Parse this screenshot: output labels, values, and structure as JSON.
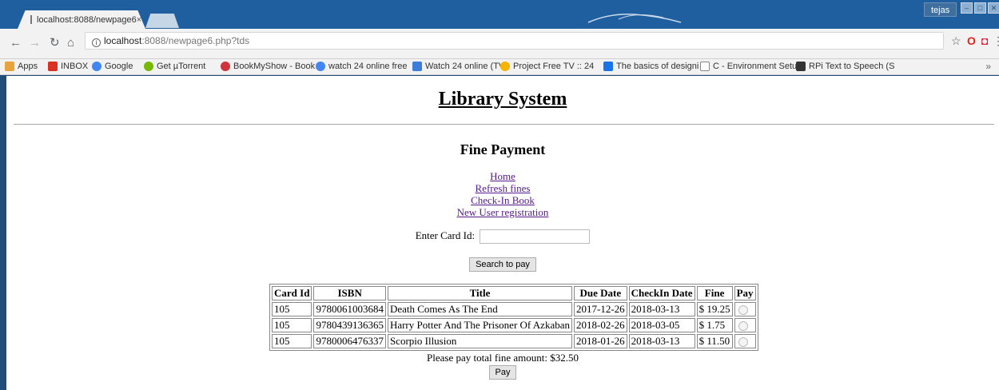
{
  "browser": {
    "tab_title": "localhost:8088/newpage6",
    "tab_close": "×",
    "url_host": "localhost",
    "url_rest": ":8088/newpage6.php?tds",
    "user": "tejas",
    "bookmarks": [
      {
        "label": "Apps",
        "color": "#e8a33d"
      },
      {
        "label": "INBOX",
        "color": "#d93025"
      },
      {
        "label": "Google",
        "color": "#4285f4"
      },
      {
        "label": "Get µTorrent",
        "color": "#76b900"
      },
      {
        "label": "BookMyShow - Book",
        "color": "#d1333d"
      },
      {
        "label": "watch 24 online free",
        "color": "#4285f4"
      },
      {
        "label": "Watch 24 online (TV",
        "color": "#3b7dd8"
      },
      {
        "label": "Project Free TV :: 24",
        "color": "#f4b400"
      },
      {
        "label": "The basics of designi",
        "color": "#1a73e8"
      },
      {
        "label": "C - Environment Setu",
        "color": "#888888"
      },
      {
        "label": "RPi Text to Speech (S",
        "color": "#333333"
      }
    ],
    "more": "»"
  },
  "page": {
    "title": "Library System",
    "subtitle": "Fine Payment",
    "links": {
      "home": "Home",
      "refresh": "Refresh fines",
      "checkin": "Check-In Book",
      "register": "New User registration"
    },
    "card_label": "Enter Card Id:",
    "card_value": "",
    "search_button": "Search to pay",
    "table": {
      "headers": [
        "Card Id",
        "ISBN",
        "Title",
        "Due Date",
        "CheckIn Date",
        "Fine",
        "Pay"
      ],
      "rows": [
        {
          "card": "105",
          "isbn": "9780061003684",
          "title": "Death Comes As The End",
          "due": "2017-12-26",
          "checkin": "2018-03-13",
          "fine": "$ 19.25"
        },
        {
          "card": "105",
          "isbn": "9780439136365",
          "title": "Harry Potter And The Prisoner Of Azkaban",
          "due": "2018-02-26",
          "checkin": "2018-03-05",
          "fine": "$ 1.75"
        },
        {
          "card": "105",
          "isbn": "9780006476337",
          "title": "Scorpio Illusion",
          "due": "2018-01-26",
          "checkin": "2018-03-13",
          "fine": "$ 11.50"
        }
      ]
    },
    "total_text": "Please pay total fine amount: $32.50",
    "pay_button": "Pay"
  }
}
